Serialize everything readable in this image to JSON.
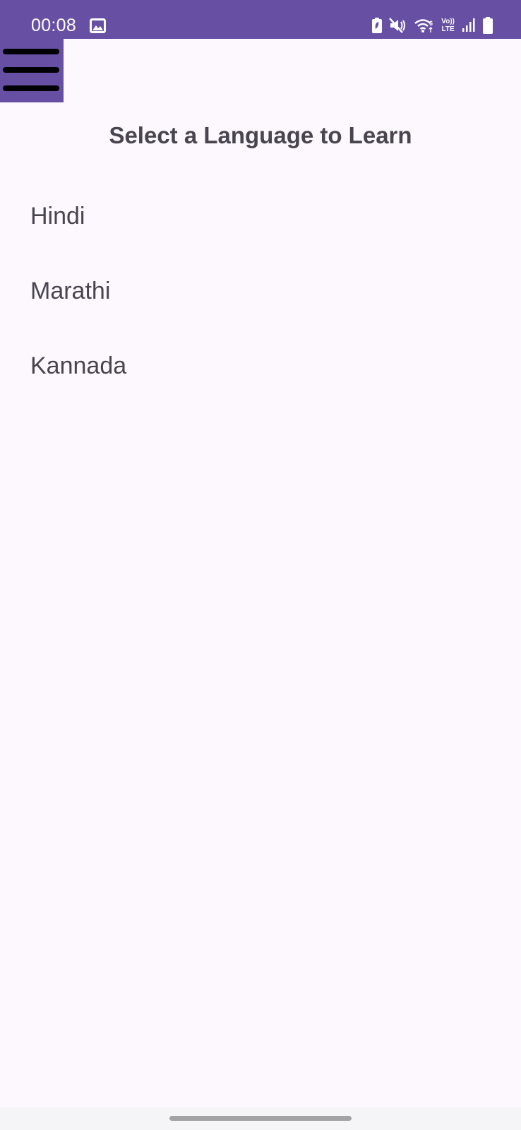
{
  "status_bar": {
    "time": "00:08",
    "volte_top": "Vo))",
    "volte_bottom": "LTE",
    "icons": [
      "gallery-icon",
      "battery-saver-icon",
      "mute-icon",
      "wifi-icon",
      "volte-icon",
      "signal-icon",
      "battery-icon"
    ]
  },
  "app": {
    "menu_icon": "hamburger-menu-icon",
    "title": "Select a Language to Learn",
    "languages": [
      {
        "label": "Hindi"
      },
      {
        "label": "Marathi"
      },
      {
        "label": "Kannada"
      }
    ]
  },
  "colors": {
    "primary": "#6750A4",
    "background": "#FDF8FE",
    "text": "#49454F"
  }
}
